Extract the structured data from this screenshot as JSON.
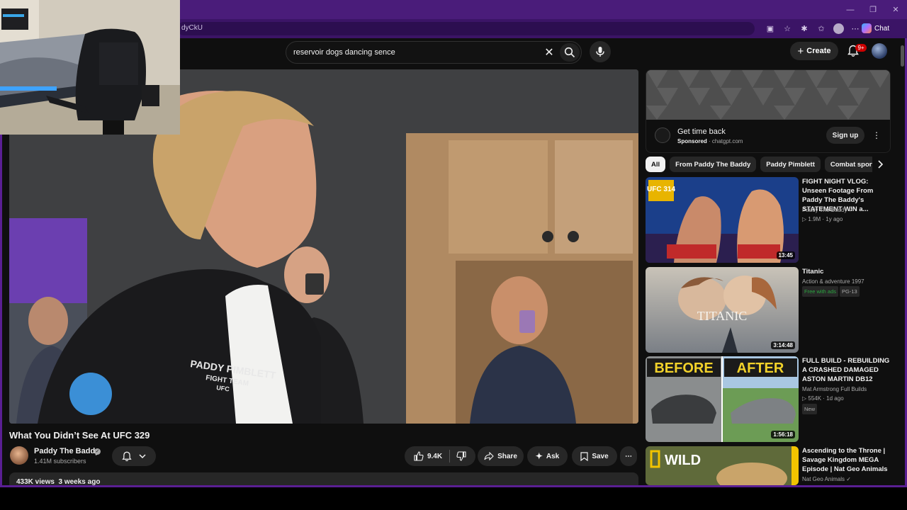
{
  "browser": {
    "url_fragment": "dyCkU",
    "copilot_label": "Chat",
    "window_controls": [
      "—",
      "❐",
      "✕"
    ]
  },
  "masthead": {
    "search_value": "reservoir dogs dancing sence",
    "create_label": "Create",
    "notifications_badge": "9+"
  },
  "video": {
    "title": "What You Didn’t See At UFC 329",
    "channel": "Paddy The Baddy",
    "subscribers": "1.41M subscribers",
    "likes": "9.4K",
    "share_label": "Share",
    "ask_label": "Ask",
    "save_label": "Save",
    "views": "433K views",
    "age": "3 weeks ago",
    "jacket_text_1": "PADDY PIMBLETT",
    "jacket_text_2": "FIGHT TEAM",
    "jacket_text_3": "UFC"
  },
  "ad": {
    "title": "Get time back",
    "sponsored": "Sponsored",
    "domain": "chatgpt.com",
    "cta": "Sign up"
  },
  "chips": [
    "All",
    "From Paddy The Baddy",
    "Paddy Pimblett",
    "Combat sports"
  ],
  "recommendations": [
    {
      "title": "FIGHT NIGHT VLOG: Unseen Footage From Paddy The Baddy's STATEMENT WIN a...",
      "channel": "Paddy The Baddy",
      "stats": "1.9M · 1y ago",
      "duration": "13:45",
      "thumb_label": "UFC 314"
    },
    {
      "title": "Titanic",
      "channel": "Action & adventure 1997",
      "tag1": "Free with ads",
      "tag2": "PG-13",
      "duration": "3:14:48",
      "thumb_label": "TITANIC"
    },
    {
      "title": "FULL BUILD - REBUILDING A CRASHED DAMAGED ASTON MARTIN DB12",
      "channel": "Mat Armstrong Full Builds",
      "stats": "554K · 1d ago",
      "badge": "New",
      "duration": "1:56:18",
      "thumb_left": "BEFORE",
      "thumb_right": "AFTER"
    },
    {
      "title": "Ascending to the Throne | Savage Kingdom MEGA Episode | Nat Geo Animals",
      "channel": "Nat Geo Animals",
      "thumb_label": "WILD"
    }
  ],
  "colors": {
    "brand_purple": "#5a1f93",
    "page_bg": "#0f0f0f",
    "badge_red": "#cc0000"
  }
}
